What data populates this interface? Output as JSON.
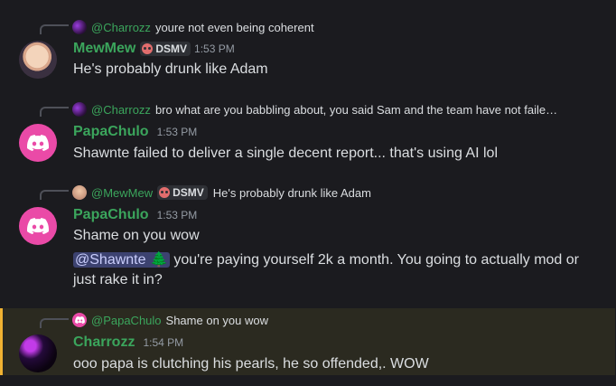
{
  "messages": [
    {
      "reply": {
        "author": "@Charrozz",
        "text": "youre not even being coherent",
        "author_color": "#3ba55c"
      },
      "author": "MewMew",
      "author_color": "#3ba55c",
      "tag": "DSMV",
      "time": "1:53 PM",
      "lines": [
        "He's probably drunk like Adam"
      ]
    },
    {
      "reply": {
        "author": "@Charrozz",
        "text": "bro what are you babbling about, you said Sam and the team have not faile…",
        "author_color": "#3ba55c"
      },
      "author": "PapaChulo",
      "author_color": "#3ba55c",
      "time": "1:53 PM",
      "lines": [
        "Shawnte failed to deliver a single decent report... that's using AI lol"
      ]
    },
    {
      "reply": {
        "author": "@MewMew",
        "tag": "DSMV",
        "text": "He's probably drunk like Adam",
        "author_color": "#3ba55c"
      },
      "author": "PapaChulo",
      "author_color": "#3ba55c",
      "time": "1:53 PM",
      "lines": [
        "Shame on you wow"
      ],
      "mention": "@Shawnte 🌲",
      "mention_rest_1": " you're paying yourself 2k a month. You going to actually mod or",
      "mention_rest_2": "just rake it in?"
    },
    {
      "reply": {
        "author": "@PapaChulo",
        "text": "Shame on you wow",
        "author_color": "#3ba55c"
      },
      "author": "Charrozz",
      "author_color": "#3ba55c",
      "time": "1:54 PM",
      "lines": [
        "ooo papa is clutching his pearls, he so offended,. WOW"
      ],
      "highlighted": true
    }
  ]
}
